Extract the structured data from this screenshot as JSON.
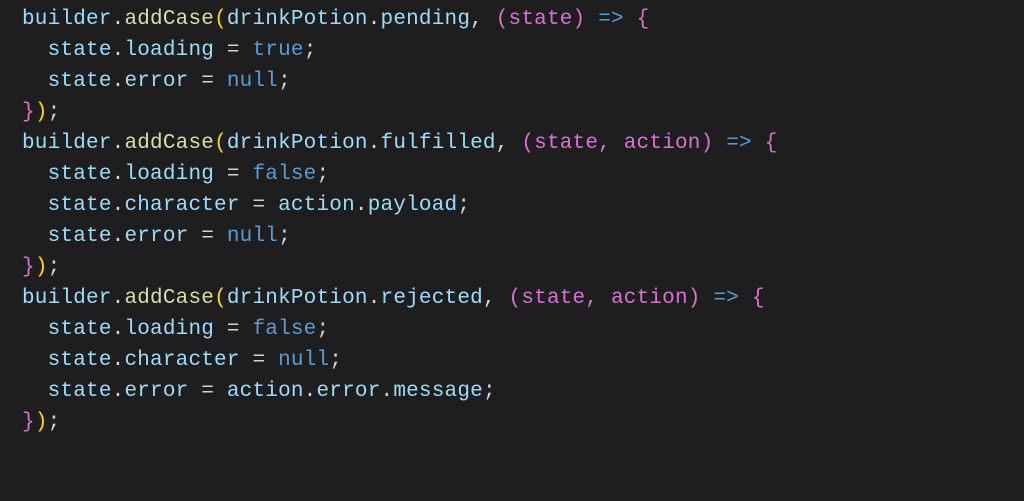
{
  "code": {
    "blocks": [
      {
        "call_prefix": "builder",
        "method": "addCase",
        "thunk_obj": "drinkPotion",
        "thunk_prop": "pending",
        "cb_params": "(state)",
        "body": [
          {
            "lhs_obj": "state",
            "lhs_prop": "loading",
            "rhs_kind": "keyword",
            "rhs_text": "true"
          },
          {
            "lhs_obj": "state",
            "lhs_prop": "error",
            "rhs_kind": "keyword",
            "rhs_text": "null"
          }
        ]
      },
      {
        "call_prefix": "builder",
        "method": "addCase",
        "thunk_obj": "drinkPotion",
        "thunk_prop": "fulfilled",
        "cb_params": "(state, action)",
        "body": [
          {
            "lhs_obj": "state",
            "lhs_prop": "loading",
            "rhs_kind": "keyword",
            "rhs_text": "false"
          },
          {
            "lhs_obj": "state",
            "lhs_prop": "character",
            "rhs_kind": "expr",
            "rhs_text": "action.payload"
          },
          {
            "lhs_obj": "state",
            "lhs_prop": "error",
            "rhs_kind": "keyword",
            "rhs_text": "null"
          }
        ]
      },
      {
        "call_prefix": "builder",
        "method": "addCase",
        "thunk_obj": "drinkPotion",
        "thunk_prop": "rejected",
        "cb_params": "(state, action)",
        "body": [
          {
            "lhs_obj": "state",
            "lhs_prop": "loading",
            "rhs_kind": "keyword",
            "rhs_text": "false"
          },
          {
            "lhs_obj": "state",
            "lhs_prop": "character",
            "rhs_kind": "keyword",
            "rhs_text": "null"
          },
          {
            "lhs_obj": "state",
            "lhs_prop": "error",
            "rhs_kind": "expr",
            "rhs_text": "action.error.message"
          }
        ]
      }
    ]
  }
}
